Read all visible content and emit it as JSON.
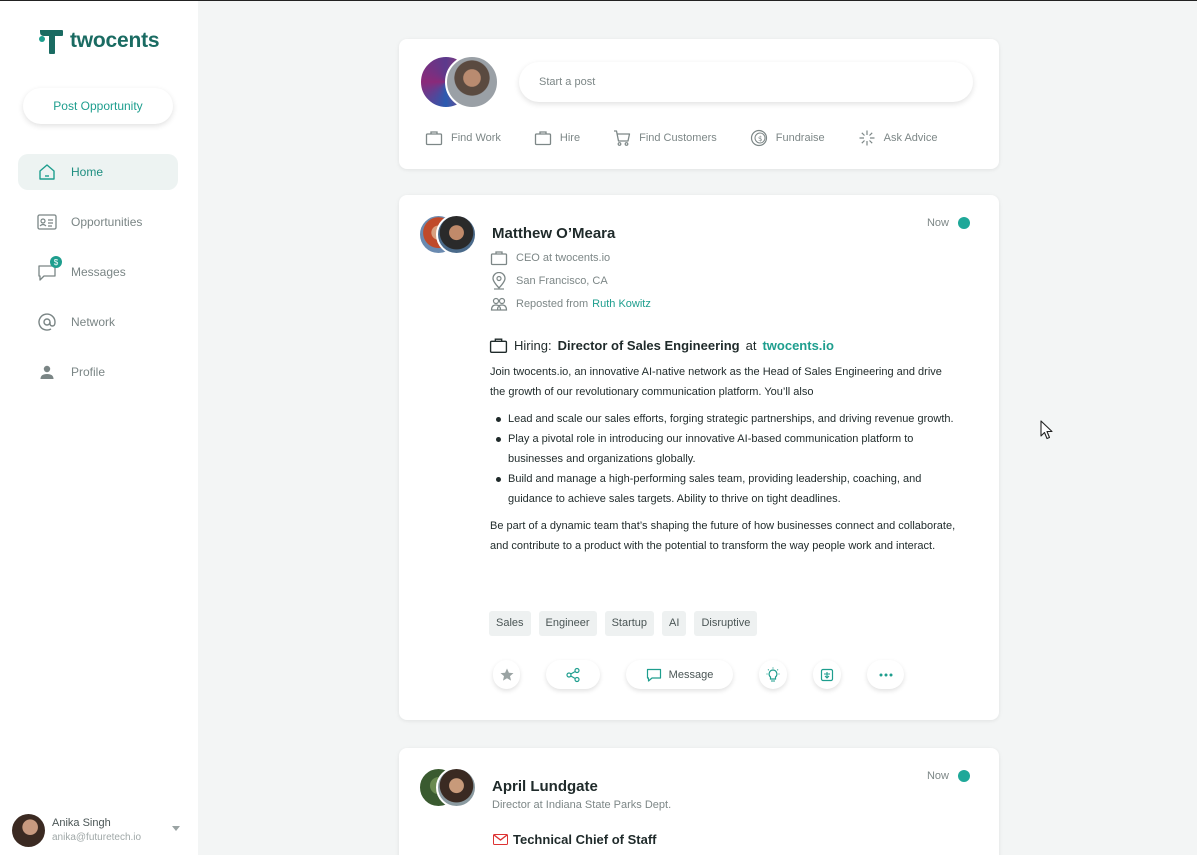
{
  "app": {
    "logo_text": "twocents",
    "post_opportunity_label": "Post Opportunity"
  },
  "sidebar": {
    "items": [
      {
        "label": "Home",
        "icon": "home-icon",
        "active": true
      },
      {
        "label": "Opportunities",
        "icon": "id-card-icon"
      },
      {
        "label": "Messages",
        "icon": "chat-icon",
        "badge": "$"
      },
      {
        "label": "Network",
        "icon": "at-icon"
      },
      {
        "label": "Profile",
        "icon": "person-icon"
      }
    ],
    "user": {
      "name": "Anika Singh",
      "email": "anika@futuretech.io"
    }
  },
  "composer": {
    "placeholder": "Start a post",
    "actions": [
      "Find Work",
      "Hire",
      "Find Customers",
      "Fundraise",
      "Ask Advice"
    ]
  },
  "posts": [
    {
      "author": "Matthew O’Meara",
      "time": "Now",
      "role": "CEO at twocents.io",
      "location": "San Francisco, CA",
      "reposted_prefix": "Reposted from",
      "reposted_from": "Ruth Kowitz",
      "hiring_prefix": "Hiring:",
      "hiring_title": "Director of Sales Engineering",
      "hiring_at": "at",
      "hiring_company": "twocents.io",
      "intro": "Join twocents.io, an innovative AI-native network as the Head of Sales Engineering and drive the growth of our revolutionary communication platform. You’ll also",
      "bullets": [
        "Lead and scale  our sales efforts, forging strategic partnerships, and driving revenue growth.",
        "Play a pivotal role in introducing our innovative AI-based communication platform to businesses and organizations globally.",
        "Build and manage a high-performing sales team, providing leadership, coaching, and guidance to achieve sales targets. Ability to thrive on tight deadlines."
      ],
      "outro": "Be part of a dynamic team that’s shaping the future of how businesses connect and collaborate, and contribute to a product with the potential to transform the way people work and interact.",
      "tags": [
        "Sales",
        "Engineer",
        "Startup",
        "AI",
        "Disruptive"
      ],
      "message_label": "Message"
    },
    {
      "author": "April Lundgate",
      "time": "Now",
      "role": "Director at Indiana State Parks Dept.",
      "hiring_title": "Technical Chief of Staff"
    }
  ],
  "colors": {
    "accent": "#1e9e8e",
    "brand": "#1a6b62",
    "online": "#1fa899"
  }
}
